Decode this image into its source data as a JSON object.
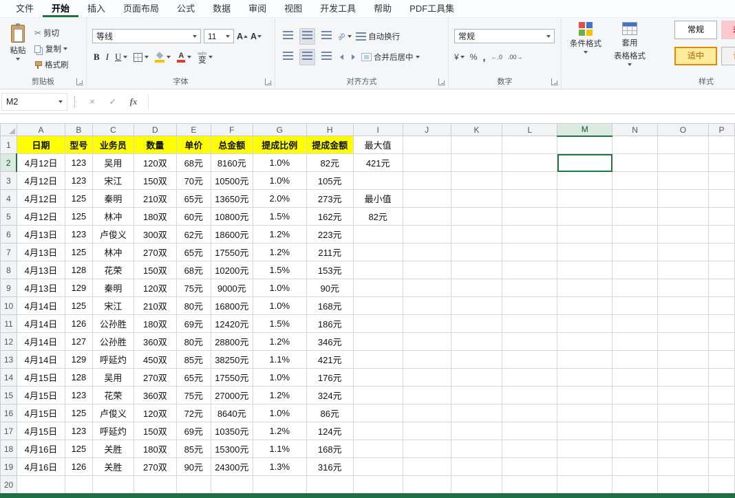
{
  "menu": {
    "tabs": [
      "文件",
      "开始",
      "插入",
      "页面布局",
      "公式",
      "数据",
      "审阅",
      "视图",
      "开发工具",
      "帮助",
      "PDF工具集"
    ],
    "active_tab": "开始"
  },
  "ribbon": {
    "clipboard": {
      "group_label": "剪贴板",
      "paste": "粘贴",
      "cut": "剪切",
      "copy": "复制",
      "format_painter": "格式刷"
    },
    "font": {
      "group_label": "字体",
      "font_name": "等线",
      "font_size": "11",
      "bold": "B",
      "italic": "I",
      "underline": "U",
      "phonetic": "变"
    },
    "alignment": {
      "group_label": "对齐方式",
      "wrap_text": "自动换行",
      "merge_center": "合并后居中"
    },
    "number": {
      "group_label": "数字",
      "format": "常规"
    },
    "styles": {
      "group_label": "样式",
      "conditional": "条件格式",
      "format_table_line1": "套用",
      "format_table_line2": "表格格式",
      "style_normal": "常规",
      "style_bad": "差",
      "style_moderate": "适中",
      "style_calc": "计"
    }
  },
  "icons": {
    "cut": "✂",
    "cancel": "×",
    "enter": "✓",
    "fx": "fx",
    "currency": "¥",
    "percent": "%",
    "comma": ",",
    "increase_decimal": "←.0",
    "decrease_decimal": ".00→",
    "grow_font": "A",
    "shrink_font": "A",
    "orientation": "ab",
    "phonetic_hint": "wén"
  },
  "formula_bar": {
    "name_box": "M2"
  },
  "sheet": {
    "selected_cell": "M2",
    "selected_col": "M",
    "selected_row": 2,
    "col_headers": [
      "A",
      "B",
      "C",
      "D",
      "E",
      "F",
      "G",
      "H",
      "I",
      "J",
      "K",
      "L",
      "M",
      "N",
      "O",
      "P"
    ],
    "rows": [
      {
        "n": 1,
        "cells": [
          "日期",
          "型号",
          "业务员",
          "数量",
          "单价",
          "总金额",
          "提成比例",
          "提成金额",
          "最大值"
        ]
      },
      {
        "n": 2,
        "cells": [
          "4月12日",
          "123",
          "吴用",
          "120双",
          "68元",
          "8160元",
          "1.0%",
          "82元",
          "421元"
        ]
      },
      {
        "n": 3,
        "cells": [
          "4月12日",
          "123",
          "宋江",
          "150双",
          "70元",
          "10500元",
          "1.0%",
          "105元",
          ""
        ]
      },
      {
        "n": 4,
        "cells": [
          "4月12日",
          "125",
          "秦明",
          "210双",
          "65元",
          "13650元",
          "2.0%",
          "273元",
          "最小值"
        ]
      },
      {
        "n": 5,
        "cells": [
          "4月12日",
          "125",
          "林冲",
          "180双",
          "60元",
          "10800元",
          "1.5%",
          "162元",
          "82元"
        ]
      },
      {
        "n": 6,
        "cells": [
          "4月13日",
          "123",
          "卢俊义",
          "300双",
          "62元",
          "18600元",
          "1.2%",
          "223元",
          ""
        ]
      },
      {
        "n": 7,
        "cells": [
          "4月13日",
          "125",
          "林冲",
          "270双",
          "65元",
          "17550元",
          "1.2%",
          "211元",
          ""
        ]
      },
      {
        "n": 8,
        "cells": [
          "4月13日",
          "128",
          "花荣",
          "150双",
          "68元",
          "10200元",
          "1.5%",
          "153元",
          ""
        ]
      },
      {
        "n": 9,
        "cells": [
          "4月13日",
          "129",
          "秦明",
          "120双",
          "75元",
          "9000元",
          "1.0%",
          "90元",
          ""
        ]
      },
      {
        "n": 10,
        "cells": [
          "4月14日",
          "125",
          "宋江",
          "210双",
          "80元",
          "16800元",
          "1.0%",
          "168元",
          ""
        ]
      },
      {
        "n": 11,
        "cells": [
          "4月14日",
          "126",
          "公孙胜",
          "180双",
          "69元",
          "12420元",
          "1.5%",
          "186元",
          ""
        ]
      },
      {
        "n": 12,
        "cells": [
          "4月14日",
          "127",
          "公孙胜",
          "360双",
          "80元",
          "28800元",
          "1.2%",
          "346元",
          ""
        ]
      },
      {
        "n": 13,
        "cells": [
          "4月14日",
          "129",
          "呼延灼",
          "450双",
          "85元",
          "38250元",
          "1.1%",
          "421元",
          ""
        ]
      },
      {
        "n": 14,
        "cells": [
          "4月15日",
          "128",
          "吴用",
          "270双",
          "65元",
          "17550元",
          "1.0%",
          "176元",
          ""
        ]
      },
      {
        "n": 15,
        "cells": [
          "4月15日",
          "123",
          "花荣",
          "360双",
          "75元",
          "27000元",
          "1.2%",
          "324元",
          ""
        ]
      },
      {
        "n": 16,
        "cells": [
          "4月15日",
          "125",
          "卢俊义",
          "120双",
          "72元",
          "8640元",
          "1.0%",
          "86元",
          ""
        ]
      },
      {
        "n": 17,
        "cells": [
          "4月15日",
          "123",
          "呼延灼",
          "150双",
          "69元",
          "10350元",
          "1.2%",
          "124元",
          ""
        ]
      },
      {
        "n": 18,
        "cells": [
          "4月16日",
          "125",
          "关胜",
          "180双",
          "85元",
          "15300元",
          "1.1%",
          "168元",
          ""
        ]
      },
      {
        "n": 19,
        "cells": [
          "4月16日",
          "126",
          "关胜",
          "270双",
          "90元",
          "24300元",
          "1.3%",
          "316元",
          ""
        ]
      },
      {
        "n": 20,
        "cells": []
      }
    ]
  }
}
